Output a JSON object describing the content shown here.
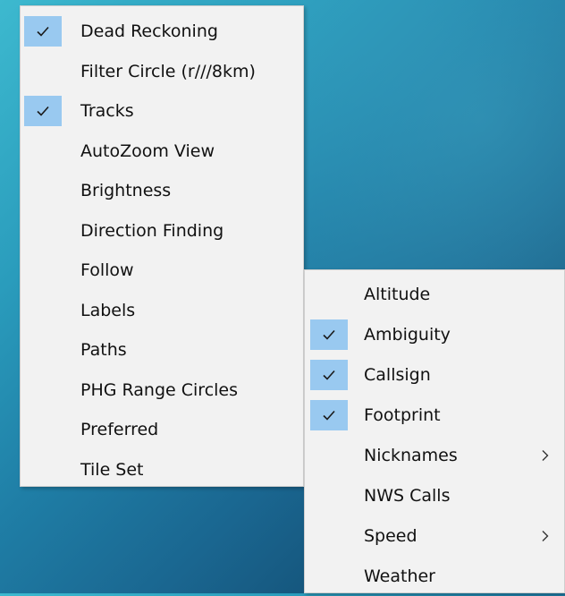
{
  "main_menu": {
    "items": [
      {
        "label": "Dead Reckoning",
        "checked": true
      },
      {
        "label": "Filter Circle (r///8km)",
        "checked": false
      },
      {
        "label": "Tracks",
        "checked": true
      },
      {
        "label": "AutoZoom View",
        "checked": false
      },
      {
        "label": "Brightness",
        "checked": false
      },
      {
        "label": "Direction Finding",
        "checked": false
      },
      {
        "label": "Follow",
        "checked": false
      },
      {
        "label": "Labels",
        "checked": false
      },
      {
        "label": "Paths",
        "checked": false
      },
      {
        "label": "PHG Range Circles",
        "checked": false
      },
      {
        "label": "Preferred",
        "checked": false
      },
      {
        "label": "Tile Set",
        "checked": false
      }
    ]
  },
  "labels_submenu": {
    "items": [
      {
        "label": "Altitude",
        "checked": false,
        "has_submenu": false
      },
      {
        "label": "Ambiguity",
        "checked": true,
        "has_submenu": false
      },
      {
        "label": "Callsign",
        "checked": true,
        "has_submenu": false
      },
      {
        "label": "Footprint",
        "checked": true,
        "has_submenu": false
      },
      {
        "label": "Nicknames",
        "checked": false,
        "has_submenu": true
      },
      {
        "label": "NWS Calls",
        "checked": false,
        "has_submenu": false
      },
      {
        "label": "Speed",
        "checked": false,
        "has_submenu": true
      },
      {
        "label": "Weather",
        "checked": false,
        "has_submenu": false
      }
    ]
  },
  "colors": {
    "check_highlight": "#99c9f0",
    "menu_background": "#f2f2f2",
    "text": "#111111"
  },
  "icons": {
    "check": "checkmark-icon",
    "submenu": "chevron-right-icon"
  }
}
